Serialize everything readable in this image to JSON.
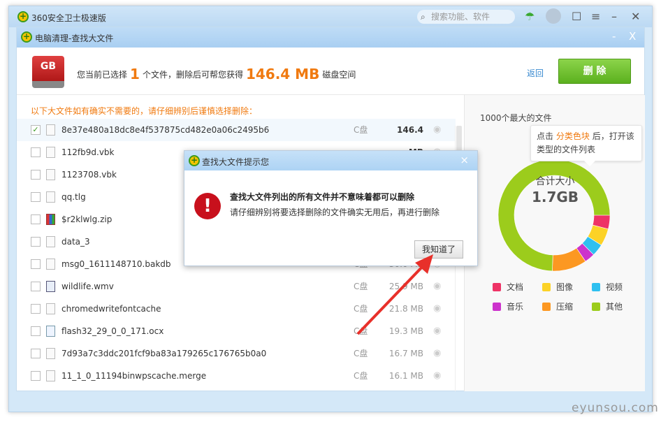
{
  "app": {
    "title": "360安全卫士极速版",
    "search_placeholder": "搜索功能、软件"
  },
  "window": {
    "title": "电脑清理-查找大文件",
    "minimize": "-",
    "close": "X"
  },
  "header": {
    "icon_label": "GB",
    "prefix": "您当前已选择",
    "count": "1",
    "middle": "个文件，删除后可帮您获得",
    "size": "146.4 MB",
    "suffix": "磁盘空间",
    "back_label": "返回",
    "delete_label": "删 除"
  },
  "notice": "以下大文件如有确实不需要的，请仔细辨别后谨慎选择删除：",
  "files": [
    {
      "name": "8e37e480a18dc8e4f537875cd482e0a06c2495b6",
      "drive": "C盘",
      "size": "146.4 MB",
      "checked": true,
      "icon": "file"
    },
    {
      "name": "112fb9d.vbk",
      "drive": "",
      "size": "",
      "checked": false,
      "icon": "file"
    },
    {
      "name": "1123708.vbk",
      "drive": "",
      "size": "",
      "checked": false,
      "icon": "file"
    },
    {
      "name": "qq.tlg",
      "drive": "",
      "size": "",
      "checked": false,
      "icon": "file"
    },
    {
      "name": "$r2klwlg.zip",
      "drive": "",
      "size": "",
      "checked": false,
      "icon": "zip"
    },
    {
      "name": "data_3",
      "drive": "",
      "size": "",
      "checked": false,
      "icon": "file"
    },
    {
      "name": "msg0_1611148710.bakdb",
      "drive": "C盘",
      "size": "30.0 MB",
      "checked": false,
      "icon": "file"
    },
    {
      "name": "wildlife.wmv",
      "drive": "C盘",
      "size": "25.9 MB",
      "checked": false,
      "icon": "vid"
    },
    {
      "name": "chromedwritefontcache",
      "drive": "C盘",
      "size": "21.8 MB",
      "checked": false,
      "icon": "file"
    },
    {
      "name": "flash32_29_0_0_171.ocx",
      "drive": "C盘",
      "size": "19.3 MB",
      "checked": false,
      "icon": "ocx"
    },
    {
      "name": "7d93a7c3ddc201fcf9ba83a179265c176765b0a0",
      "drive": "C盘",
      "size": "16.7 MB",
      "checked": false,
      "icon": "file"
    },
    {
      "name": "11_1_0_11194binwpscache.merge",
      "drive": "C盘",
      "size": "16.1 MB",
      "checked": false,
      "icon": "file"
    }
  ],
  "side": {
    "title": "1000个最大的文件",
    "tip_a": "点击",
    "tip_hl": "分类色块",
    "tip_b": "后，打开该类型的文件列表",
    "total_label": "合计大小",
    "total_value": "1.7GB"
  },
  "chart_data": {
    "type": "pie",
    "categories": [
      "文档",
      "图像",
      "视频",
      "音乐",
      "压缩",
      "其他"
    ],
    "values": [
      4,
      5,
      3.5,
      3,
      10,
      74.5
    ],
    "colors": [
      "#ee3366",
      "#fcd227",
      "#2fc0f0",
      "#cc33cc",
      "#fc9822",
      "#9ccc1c"
    ],
    "unit": "percent (estimated)"
  },
  "dialog": {
    "title": "查找大文件提示您",
    "line1": "查找大文件列出的所有文件并不意味着都可以删除",
    "line2": "请仔细辨别将要选择删除的文件确实无用后，再进行删除",
    "ok_label": "我知道了",
    "close": "×"
  },
  "watermark": "eyunsou.com"
}
